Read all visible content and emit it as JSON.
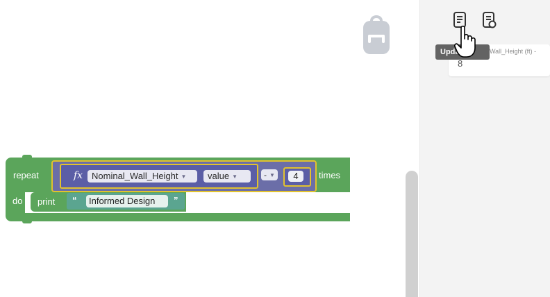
{
  "workspace": {
    "repeat_block": {
      "repeat_label": "repeat",
      "times_label": "times",
      "do_label": "do",
      "fx_symbol": "fx",
      "variable_name": "Nominal_Wall_Height",
      "property": "value",
      "operator": "-",
      "number": "4"
    },
    "print_block": {
      "print_label": "print",
      "open_quote": "“",
      "close_quote": "”",
      "text": "Informed Design"
    }
  },
  "right_panel": {
    "tooltip": "Update",
    "field_label": "Wall_Height (ft) -",
    "field_value": "8",
    "icons": [
      "update-icon",
      "document-settings-icon"
    ]
  },
  "colors": {
    "loop_green": "#5ba55b",
    "math_purple": "#5b5ea6",
    "highlight_yellow": "#e2c22e",
    "text_teal": "#5ba590",
    "tooltip_gray": "#636363"
  }
}
